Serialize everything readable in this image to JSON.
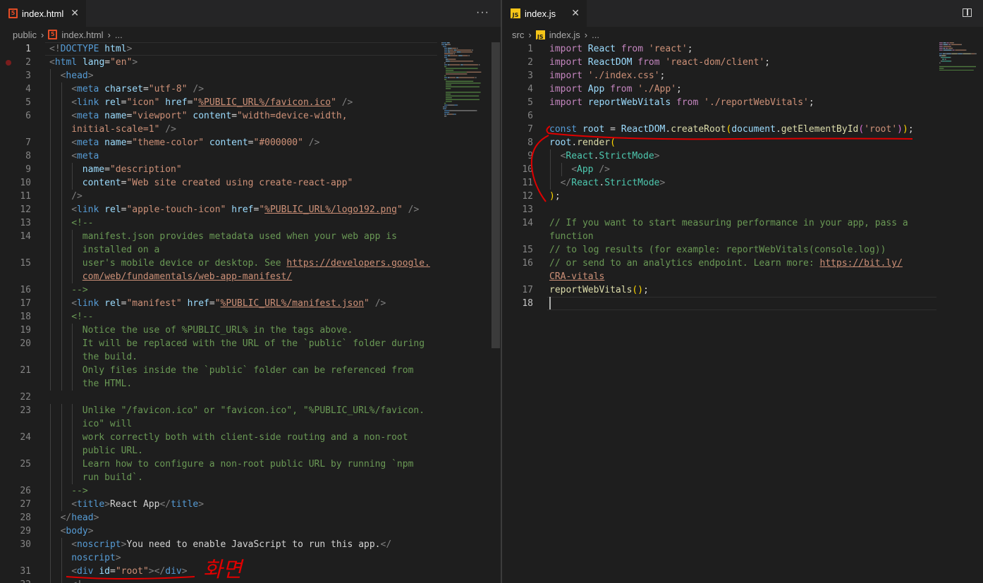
{
  "left_editor": {
    "tab": {
      "label": "index.html",
      "badge": "5",
      "close": "✕"
    },
    "more": "···",
    "breadcrumb": {
      "folder": "public",
      "file": "index.html",
      "tail": "..."
    },
    "active_line": 1,
    "breakpoint_line": 2
  },
  "right_editor": {
    "tab": {
      "label": "index.js",
      "badge": "JS",
      "close": "✕"
    },
    "breadcrumb": {
      "folder": "src",
      "file": "index.js",
      "tail": "..."
    },
    "active_line": 18
  },
  "annotation": {
    "text": "화면",
    "color": "#e00000"
  },
  "html_lines": [
    {
      "n": "1",
      "t": [
        [
          "tk-gray",
          "<!"
        ],
        [
          "tk-tag",
          "DOCTYPE"
        ],
        [
          "tk-txt",
          " "
        ],
        [
          "tk-attr",
          "html"
        ],
        [
          "tk-gray",
          ">"
        ]
      ]
    },
    {
      "n": "2",
      "t": [
        [
          "tk-gray",
          "<"
        ],
        [
          "tk-tag",
          "html"
        ],
        [
          "tk-txt",
          " "
        ],
        [
          "tk-attr",
          "lang"
        ],
        [
          "tk-txt",
          "="
        ],
        [
          "tk-str",
          "\"en\""
        ],
        [
          "tk-gray",
          ">"
        ]
      ]
    },
    {
      "n": "3",
      "i": 1,
      "t": [
        [
          "tk-gray",
          "<"
        ],
        [
          "tk-tag",
          "head"
        ],
        [
          "tk-gray",
          ">"
        ]
      ]
    },
    {
      "n": "4",
      "i": 2,
      "t": [
        [
          "tk-gray",
          "<"
        ],
        [
          "tk-tag",
          "meta"
        ],
        [
          "tk-txt",
          " "
        ],
        [
          "tk-attr",
          "charset"
        ],
        [
          "tk-txt",
          "="
        ],
        [
          "tk-str",
          "\"utf-8\""
        ],
        [
          "tk-txt",
          " "
        ],
        [
          "tk-gray",
          "/>"
        ]
      ]
    },
    {
      "n": "5",
      "i": 2,
      "t": [
        [
          "tk-gray",
          "<"
        ],
        [
          "tk-tag",
          "link"
        ],
        [
          "tk-txt",
          " "
        ],
        [
          "tk-attr",
          "rel"
        ],
        [
          "tk-txt",
          "="
        ],
        [
          "tk-str",
          "\"icon\""
        ],
        [
          "tk-txt",
          " "
        ],
        [
          "tk-attr",
          "href"
        ],
        [
          "tk-txt",
          "="
        ],
        [
          "tk-str",
          "\""
        ],
        [
          "tk-link",
          "%PUBLIC_URL%/favicon.ico"
        ],
        [
          "tk-str",
          "\""
        ],
        [
          "tk-txt",
          " "
        ],
        [
          "tk-gray",
          "/>"
        ]
      ]
    },
    {
      "n": "6",
      "i": 2,
      "t": [
        [
          "tk-gray",
          "<"
        ],
        [
          "tk-tag",
          "meta"
        ],
        [
          "tk-txt",
          " "
        ],
        [
          "tk-attr",
          "name"
        ],
        [
          "tk-txt",
          "="
        ],
        [
          "tk-str",
          "\"viewport\""
        ],
        [
          "tk-txt",
          " "
        ],
        [
          "tk-attr",
          "content"
        ],
        [
          "tk-txt",
          "="
        ],
        [
          "tk-str",
          "\"width=device-width,"
        ]
      ]
    },
    {
      "n": "",
      "i": 2,
      "t": [
        [
          "tk-str",
          "initial-scale=1\""
        ],
        [
          "tk-txt",
          " "
        ],
        [
          "tk-gray",
          "/>"
        ]
      ]
    },
    {
      "n": "7",
      "i": 2,
      "t": [
        [
          "tk-gray",
          "<"
        ],
        [
          "tk-tag",
          "meta"
        ],
        [
          "tk-txt",
          " "
        ],
        [
          "tk-attr",
          "name"
        ],
        [
          "tk-txt",
          "="
        ],
        [
          "tk-str",
          "\"theme-color\""
        ],
        [
          "tk-txt",
          " "
        ],
        [
          "tk-attr",
          "content"
        ],
        [
          "tk-txt",
          "="
        ],
        [
          "tk-str",
          "\"#000000\""
        ],
        [
          "tk-txt",
          " "
        ],
        [
          "tk-gray",
          "/>"
        ]
      ]
    },
    {
      "n": "8",
      "i": 2,
      "t": [
        [
          "tk-gray",
          "<"
        ],
        [
          "tk-tag",
          "meta"
        ]
      ]
    },
    {
      "n": "9",
      "i": 3,
      "t": [
        [
          "tk-attr",
          "name"
        ],
        [
          "tk-txt",
          "="
        ],
        [
          "tk-str",
          "\"description\""
        ]
      ]
    },
    {
      "n": "10",
      "i": 3,
      "t": [
        [
          "tk-attr",
          "content"
        ],
        [
          "tk-txt",
          "="
        ],
        [
          "tk-str",
          "\"Web site created using create-react-app\""
        ]
      ]
    },
    {
      "n": "11",
      "i": 2,
      "t": [
        [
          "tk-gray",
          "/>"
        ]
      ]
    },
    {
      "n": "12",
      "i": 2,
      "t": [
        [
          "tk-gray",
          "<"
        ],
        [
          "tk-tag",
          "link"
        ],
        [
          "tk-txt",
          " "
        ],
        [
          "tk-attr",
          "rel"
        ],
        [
          "tk-txt",
          "="
        ],
        [
          "tk-str",
          "\"apple-touch-icon\""
        ],
        [
          "tk-txt",
          " "
        ],
        [
          "tk-attr",
          "href"
        ],
        [
          "tk-txt",
          "="
        ],
        [
          "tk-str",
          "\""
        ],
        [
          "tk-link",
          "%PUBLIC_URL%/logo192.png"
        ],
        [
          "tk-str",
          "\""
        ],
        [
          "tk-txt",
          " "
        ],
        [
          "tk-gray",
          "/>"
        ]
      ]
    },
    {
      "n": "13",
      "i": 2,
      "t": [
        [
          "tk-cmt",
          "<!--"
        ]
      ]
    },
    {
      "n": "14",
      "i": 3,
      "t": [
        [
          "tk-cmt",
          "manifest.json provides metadata used when your web app is"
        ]
      ]
    },
    {
      "n": "",
      "i": 3,
      "t": [
        [
          "tk-cmt",
          "installed on a"
        ]
      ]
    },
    {
      "n": "15",
      "i": 3,
      "t": [
        [
          "tk-cmt",
          "user's mobile device or desktop. See "
        ],
        [
          "tk-link",
          "https://developers.google."
        ]
      ]
    },
    {
      "n": "",
      "i": 3,
      "t": [
        [
          "tk-link",
          "com/web/fundamentals/web-app-manifest/"
        ]
      ]
    },
    {
      "n": "16",
      "i": 2,
      "t": [
        [
          "tk-cmt",
          "-->"
        ]
      ]
    },
    {
      "n": "17",
      "i": 2,
      "t": [
        [
          "tk-gray",
          "<"
        ],
        [
          "tk-tag",
          "link"
        ],
        [
          "tk-txt",
          " "
        ],
        [
          "tk-attr",
          "rel"
        ],
        [
          "tk-txt",
          "="
        ],
        [
          "tk-str",
          "\"manifest\""
        ],
        [
          "tk-txt",
          " "
        ],
        [
          "tk-attr",
          "href"
        ],
        [
          "tk-txt",
          "="
        ],
        [
          "tk-str",
          "\""
        ],
        [
          "tk-link",
          "%PUBLIC_URL%/manifest.json"
        ],
        [
          "tk-str",
          "\""
        ],
        [
          "tk-txt",
          " "
        ],
        [
          "tk-gray",
          "/>"
        ]
      ]
    },
    {
      "n": "18",
      "i": 2,
      "t": [
        [
          "tk-cmt",
          "<!--"
        ]
      ]
    },
    {
      "n": "19",
      "i": 3,
      "t": [
        [
          "tk-cmt",
          "Notice the use of %PUBLIC_URL% in the tags above."
        ]
      ]
    },
    {
      "n": "20",
      "i": 3,
      "t": [
        [
          "tk-cmt",
          "It will be replaced with the URL of the `public` folder during"
        ]
      ]
    },
    {
      "n": "",
      "i": 3,
      "t": [
        [
          "tk-cmt",
          "the build."
        ]
      ]
    },
    {
      "n": "21",
      "i": 3,
      "t": [
        [
          "tk-cmt",
          "Only files inside the `public` folder can be referenced from"
        ]
      ]
    },
    {
      "n": "",
      "i": 3,
      "t": [
        [
          "tk-cmt",
          "the HTML."
        ]
      ]
    },
    {
      "n": "22",
      "i": 0,
      "t": []
    },
    {
      "n": "23",
      "i": 3,
      "t": [
        [
          "tk-cmt",
          "Unlike \"/favicon.ico\" or \"favicon.ico\", \"%PUBLIC_URL%/favicon."
        ]
      ]
    },
    {
      "n": "",
      "i": 3,
      "t": [
        [
          "tk-cmt",
          "ico\" will"
        ]
      ]
    },
    {
      "n": "24",
      "i": 3,
      "t": [
        [
          "tk-cmt",
          "work correctly both with client-side routing and a non-root"
        ]
      ]
    },
    {
      "n": "",
      "i": 3,
      "t": [
        [
          "tk-cmt",
          "public URL."
        ]
      ]
    },
    {
      "n": "25",
      "i": 3,
      "t": [
        [
          "tk-cmt",
          "Learn how to configure a non-root public URL by running `npm"
        ]
      ]
    },
    {
      "n": "",
      "i": 3,
      "t": [
        [
          "tk-cmt",
          "run build`."
        ]
      ]
    },
    {
      "n": "26",
      "i": 2,
      "t": [
        [
          "tk-cmt",
          "-->"
        ]
      ]
    },
    {
      "n": "27",
      "i": 2,
      "t": [
        [
          "tk-gray",
          "<"
        ],
        [
          "tk-tag",
          "title"
        ],
        [
          "tk-gray",
          ">"
        ],
        [
          "tk-txt",
          "React App"
        ],
        [
          "tk-gray",
          "</"
        ],
        [
          "tk-tag",
          "title"
        ],
        [
          "tk-gray",
          ">"
        ]
      ]
    },
    {
      "n": "28",
      "i": 1,
      "t": [
        [
          "tk-gray",
          "</"
        ],
        [
          "tk-tag",
          "head"
        ],
        [
          "tk-gray",
          ">"
        ]
      ]
    },
    {
      "n": "29",
      "i": 1,
      "t": [
        [
          "tk-gray",
          "<"
        ],
        [
          "tk-tag",
          "body"
        ],
        [
          "tk-gray",
          ">"
        ]
      ]
    },
    {
      "n": "30",
      "i": 2,
      "t": [
        [
          "tk-gray",
          "<"
        ],
        [
          "tk-tag",
          "noscript"
        ],
        [
          "tk-gray",
          ">"
        ],
        [
          "tk-txt",
          "You need to enable JavaScript to run this app."
        ],
        [
          "tk-gray",
          "</"
        ]
      ]
    },
    {
      "n": "",
      "i": 2,
      "t": [
        [
          "tk-tag",
          "noscript"
        ],
        [
          "tk-gray",
          ">"
        ]
      ]
    },
    {
      "n": "31",
      "i": 2,
      "t": [
        [
          "tk-gray",
          "<"
        ],
        [
          "tk-tag",
          "div"
        ],
        [
          "tk-txt",
          " "
        ],
        [
          "tk-attr",
          "id"
        ],
        [
          "tk-txt",
          "="
        ],
        [
          "tk-str",
          "\"root\""
        ],
        [
          "tk-gray",
          "></"
        ],
        [
          "tk-tag",
          "div"
        ],
        [
          "tk-gray",
          ">"
        ]
      ]
    },
    {
      "n": "32",
      "i": 2,
      "t": [
        [
          "tk-gray",
          "<!--"
        ]
      ]
    }
  ],
  "js_lines": [
    {
      "n": "1",
      "t": [
        [
          "tk-kw",
          "import"
        ],
        [
          "tk-txt",
          " "
        ],
        [
          "tk-var",
          "React"
        ],
        [
          "tk-txt",
          " "
        ],
        [
          "tk-kw",
          "from"
        ],
        [
          "tk-txt",
          " "
        ],
        [
          "tk-str",
          "'react'"
        ],
        [
          "tk-txt",
          ";"
        ]
      ]
    },
    {
      "n": "2",
      "t": [
        [
          "tk-kw",
          "import"
        ],
        [
          "tk-txt",
          " "
        ],
        [
          "tk-var",
          "ReactDOM"
        ],
        [
          "tk-txt",
          " "
        ],
        [
          "tk-kw",
          "from"
        ],
        [
          "tk-txt",
          " "
        ],
        [
          "tk-str",
          "'react-dom/client'"
        ],
        [
          "tk-txt",
          ";"
        ]
      ]
    },
    {
      "n": "3",
      "t": [
        [
          "tk-kw",
          "import"
        ],
        [
          "tk-txt",
          " "
        ],
        [
          "tk-str",
          "'./index.css'"
        ],
        [
          "tk-txt",
          ";"
        ]
      ]
    },
    {
      "n": "4",
      "t": [
        [
          "tk-kw",
          "import"
        ],
        [
          "tk-txt",
          " "
        ],
        [
          "tk-var",
          "App"
        ],
        [
          "tk-txt",
          " "
        ],
        [
          "tk-kw",
          "from"
        ],
        [
          "tk-txt",
          " "
        ],
        [
          "tk-str",
          "'./App'"
        ],
        [
          "tk-txt",
          ";"
        ]
      ]
    },
    {
      "n": "5",
      "t": [
        [
          "tk-kw",
          "import"
        ],
        [
          "tk-txt",
          " "
        ],
        [
          "tk-var",
          "reportWebVitals"
        ],
        [
          "tk-txt",
          " "
        ],
        [
          "tk-kw",
          "from"
        ],
        [
          "tk-txt",
          " "
        ],
        [
          "tk-str",
          "'./reportWebVitals'"
        ],
        [
          "tk-txt",
          ";"
        ]
      ]
    },
    {
      "n": "6",
      "t": []
    },
    {
      "n": "7",
      "t": [
        [
          "tk-blue",
          "const"
        ],
        [
          "tk-txt",
          " "
        ],
        [
          "tk-var",
          "root"
        ],
        [
          "tk-txt",
          " = "
        ],
        [
          "tk-var",
          "ReactDOM"
        ],
        [
          "tk-txt",
          "."
        ],
        [
          "tk-fn",
          "createRoot"
        ],
        [
          "tk-br",
          "("
        ],
        [
          "tk-var",
          "document"
        ],
        [
          "tk-txt",
          "."
        ],
        [
          "tk-fn",
          "getElementById"
        ],
        [
          "tk-br2",
          "("
        ],
        [
          "tk-str",
          "'root'"
        ],
        [
          "tk-br2",
          ")"
        ],
        [
          "tk-br",
          ")"
        ],
        [
          "tk-txt",
          ";"
        ]
      ]
    },
    {
      "n": "8",
      "t": [
        [
          "tk-var",
          "root"
        ],
        [
          "tk-txt",
          "."
        ],
        [
          "tk-fn",
          "render"
        ],
        [
          "tk-br",
          "("
        ]
      ]
    },
    {
      "n": "9",
      "i": 1,
      "t": [
        [
          "tk-gray",
          "<"
        ],
        [
          "tk-cls",
          "React"
        ],
        [
          "tk-txt",
          "."
        ],
        [
          "tk-cls",
          "StrictMode"
        ],
        [
          "tk-gray",
          ">"
        ]
      ]
    },
    {
      "n": "10",
      "i": 2,
      "t": [
        [
          "tk-gray",
          "<"
        ],
        [
          "tk-cls",
          "App"
        ],
        [
          "tk-txt",
          " "
        ],
        [
          "tk-gray",
          "/>"
        ]
      ]
    },
    {
      "n": "11",
      "i": 1,
      "t": [
        [
          "tk-gray",
          "</"
        ],
        [
          "tk-cls",
          "React"
        ],
        [
          "tk-txt",
          "."
        ],
        [
          "tk-cls",
          "StrictMode"
        ],
        [
          "tk-gray",
          ">"
        ]
      ]
    },
    {
      "n": "12",
      "t": [
        [
          "tk-br",
          ")"
        ],
        [
          "tk-txt",
          ";"
        ]
      ]
    },
    {
      "n": "13",
      "t": []
    },
    {
      "n": "14",
      "t": [
        [
          "tk-cmt",
          "// If you want to start measuring performance in your app, pass a"
        ]
      ]
    },
    {
      "n": "",
      "t": [
        [
          "tk-cmt",
          "function"
        ]
      ]
    },
    {
      "n": "15",
      "t": [
        [
          "tk-cmt",
          "// to log results (for example: reportWebVitals(console.log))"
        ]
      ]
    },
    {
      "n": "16",
      "t": [
        [
          "tk-cmt",
          "// or send to an analytics endpoint. Learn more: "
        ],
        [
          "tk-link",
          "https://bit.ly/"
        ]
      ]
    },
    {
      "n": "",
      "t": [
        [
          "tk-link",
          "CRA-vitals"
        ]
      ]
    },
    {
      "n": "17",
      "t": [
        [
          "tk-fn",
          "reportWebVitals"
        ],
        [
          "tk-br",
          "("
        ],
        [
          "tk-br",
          ")"
        ],
        [
          "tk-txt",
          ";"
        ]
      ]
    },
    {
      "n": "18",
      "t": []
    }
  ]
}
